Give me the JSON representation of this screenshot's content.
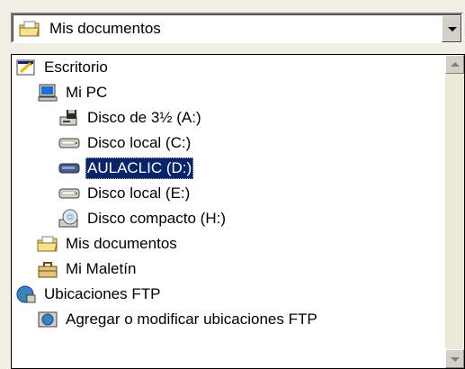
{
  "combo": {
    "selected_label": "Mis documentos",
    "icon": "folder-documents-icon"
  },
  "list": {
    "items": [
      {
        "label": "Escritorio",
        "icon": "desktop-icon",
        "level": 0
      },
      {
        "label": "Mi PC",
        "icon": "my-computer-icon",
        "level": 1
      },
      {
        "label": "Disco de 3½ (A:)",
        "icon": "floppy-drive-icon",
        "level": 2
      },
      {
        "label": "Disco local (C:)",
        "icon": "hard-drive-icon",
        "level": 2
      },
      {
        "label": "AULACLIC (D:)",
        "icon": "hard-drive-icon",
        "level": 2,
        "selected": true
      },
      {
        "label": "Disco local (E:)",
        "icon": "hard-drive-icon",
        "level": 2
      },
      {
        "label": "Disco compacto (H:)",
        "icon": "cd-drive-icon",
        "level": 2
      },
      {
        "label": "Mis documentos",
        "icon": "folder-documents-icon",
        "level": 1
      },
      {
        "label": "Mi Maletín",
        "icon": "briefcase-icon",
        "level": 1
      },
      {
        "label": "Ubicaciones FTP",
        "icon": "ftp-globe-icon",
        "level": 0
      },
      {
        "label": "Agregar o modificar ubicaciones FTP",
        "icon": "ftp-add-icon",
        "level": 1
      }
    ]
  },
  "colors": {
    "selection_bg": "#0a246a",
    "selection_text": "#ffffff",
    "window_bg": "#f1eee4"
  }
}
